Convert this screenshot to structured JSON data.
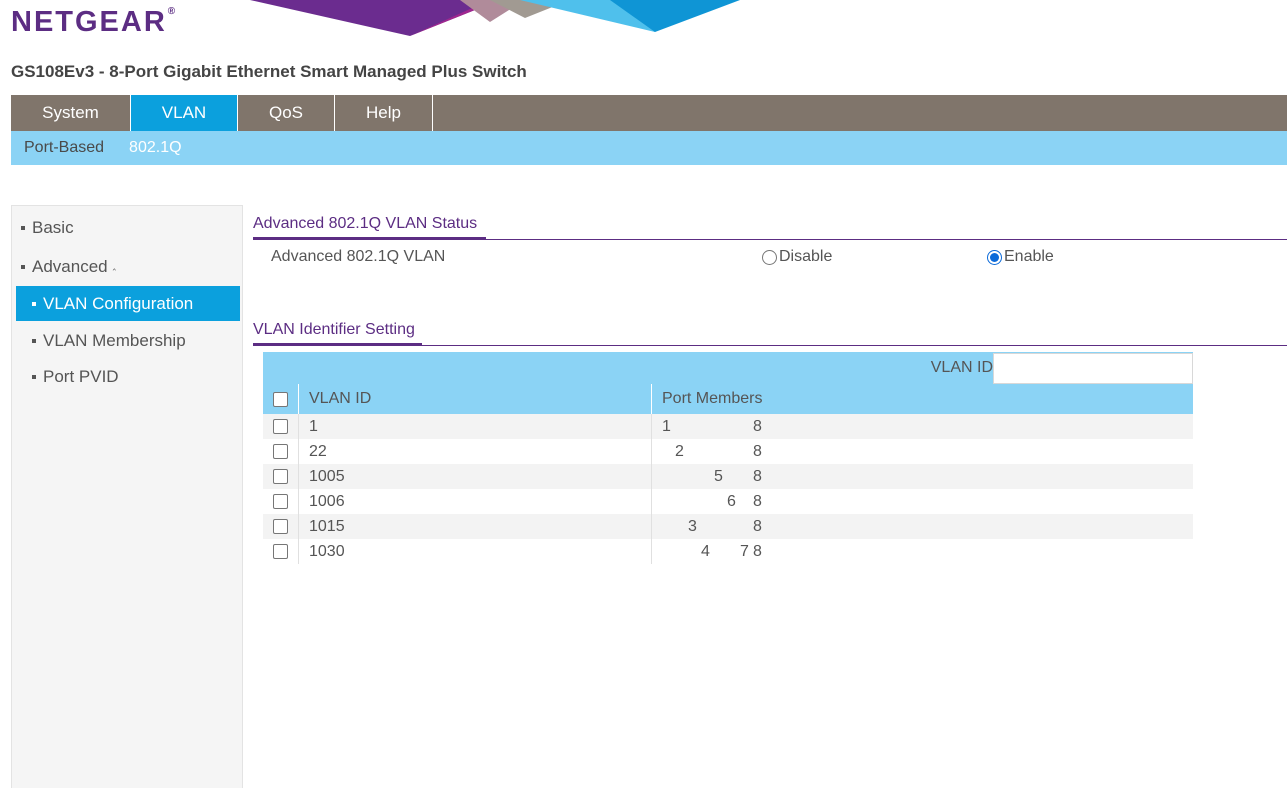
{
  "header": {
    "logo_text": "NETGEAR",
    "logo_mark": "®",
    "product_title": "GS108Ev3 - 8-Port Gigabit Ethernet Smart Managed Plus Switch"
  },
  "top_nav": {
    "tabs": [
      {
        "label": "System",
        "active": false
      },
      {
        "label": "VLAN",
        "active": true
      },
      {
        "label": "QoS",
        "active": false
      },
      {
        "label": "Help",
        "active": false
      }
    ]
  },
  "sub_nav": {
    "tabs": [
      {
        "label": "Port-Based",
        "active": false
      },
      {
        "label": "802.1Q",
        "active": true
      }
    ]
  },
  "sidebar": {
    "items": [
      {
        "label": "Basic",
        "active": false
      },
      {
        "label": "Advanced",
        "active": false,
        "expanded": true,
        "caret": "‸"
      },
      {
        "label": "VLAN Configuration",
        "active": true
      },
      {
        "label": "VLAN Membership",
        "active": false
      },
      {
        "label": "Port PVID",
        "active": false
      }
    ]
  },
  "status_section": {
    "title": "Advanced 802.1Q VLAN Status",
    "row_label": "Advanced 802.1Q VLAN",
    "options": [
      {
        "label": "Disable",
        "checked": false
      },
      {
        "label": "Enable",
        "checked": true
      }
    ]
  },
  "identifier_section": {
    "title": "VLAN Identifier Setting",
    "vlan_id_label": "VLAN ID",
    "vlan_id_value": "",
    "columns": {
      "vlan_id": "VLAN ID",
      "port_members": "Port Members"
    },
    "rows": [
      {
        "vlan_id": "1",
        "ports": [
          "1",
          "8"
        ]
      },
      {
        "vlan_id": "22",
        "ports": [
          "2",
          "8"
        ]
      },
      {
        "vlan_id": "1005",
        "ports": [
          "5",
          "8"
        ]
      },
      {
        "vlan_id": "1006",
        "ports": [
          "6",
          "8"
        ]
      },
      {
        "vlan_id": "1015",
        "ports": [
          "3",
          "8"
        ]
      },
      {
        "vlan_id": "1030",
        "ports": [
          "4",
          "7",
          "8"
        ]
      }
    ]
  },
  "colors": {
    "brand_purple": "#5c2d83",
    "nav_brown": "#80756b",
    "active_blue": "#0ba0dd",
    "light_blue": "#8bd3f5"
  }
}
